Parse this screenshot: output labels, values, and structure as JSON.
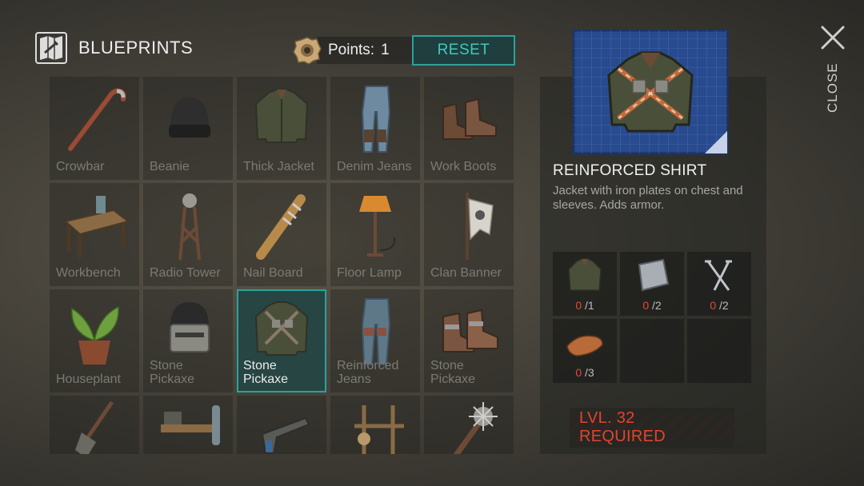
{
  "header": {
    "title": "BLUEPRINTS",
    "icon": "blueprint-map-icon"
  },
  "points": {
    "label": "Points:",
    "value": "1",
    "icon": "stone-token-icon"
  },
  "reset_label": "RESET",
  "close_label": "CLOSE",
  "grid": {
    "items": [
      {
        "label": "Crowbar",
        "icon": "crowbar-icon"
      },
      {
        "label": "Beanie",
        "icon": "beanie-icon"
      },
      {
        "label": "Thick Jacket",
        "icon": "thick-jacket-icon"
      },
      {
        "label": "Denim Jeans",
        "icon": "denim-jeans-icon"
      },
      {
        "label": "Work Boots",
        "icon": "work-boots-icon"
      },
      {
        "label": "Workbench",
        "icon": "workbench-icon"
      },
      {
        "label": "Radio Tower",
        "icon": "radio-tower-icon"
      },
      {
        "label": "Nail Board",
        "icon": "nail-board-icon"
      },
      {
        "label": "Floor Lamp",
        "icon": "floor-lamp-icon"
      },
      {
        "label": "Clan Banner",
        "icon": "clan-banner-icon"
      },
      {
        "label": "Houseplant",
        "icon": "houseplant-icon"
      },
      {
        "label": "Stone Pickaxe",
        "icon": "helmet-icon"
      },
      {
        "label": "Stone Pickaxe",
        "icon": "reinforced-shirt-icon",
        "selected": true
      },
      {
        "label": "Reinforced Jeans",
        "icon": "reinforced-jeans-icon"
      },
      {
        "label": "Stone Pickaxe",
        "icon": "reinforced-boots-icon"
      },
      {
        "label": "",
        "icon": "shovel-icon"
      },
      {
        "label": "",
        "icon": "workshop-table-icon"
      },
      {
        "label": "",
        "icon": "pistol-icon"
      },
      {
        "label": "",
        "icon": "scarecrow-icon"
      },
      {
        "label": "",
        "icon": "spiked-club-icon"
      }
    ]
  },
  "detail": {
    "name": "REINFORCED SHIRT",
    "description": "Jacket with iron plates on chest and sleeves. Adds armor.",
    "preview_icon": "reinforced-shirt-blueprint-icon",
    "materials": [
      {
        "icon": "jacket-material-icon",
        "have": "0",
        "need": "/1"
      },
      {
        "icon": "iron-plate-icon",
        "have": "0",
        "need": "/2"
      },
      {
        "icon": "nails-icon",
        "have": "0",
        "need": "/2"
      },
      {
        "icon": "leather-icon",
        "have": "0",
        "need": "/3"
      },
      {
        "icon": "",
        "have": "",
        "need": ""
      },
      {
        "icon": "",
        "have": "",
        "need": ""
      }
    ],
    "requirement": "LVL. 32 REQUIRED"
  },
  "colors": {
    "accent": "#2aa29b",
    "danger": "#e2442f",
    "selected_bg": "#264543"
  }
}
